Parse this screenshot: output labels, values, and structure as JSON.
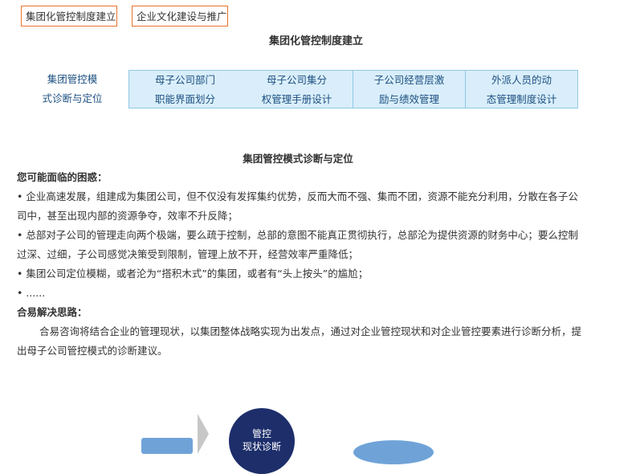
{
  "top_tabs": [
    "集团化管控制度建立",
    "企业文化建设与推广"
  ],
  "section_title": "集团化管控制度建立",
  "subnav": {
    "active": [
      "集团管控模",
      "式诊断与定位"
    ],
    "items": [
      [
        "母子公司部门",
        "职能界面划分"
      ],
      [
        "母子公司集分",
        "权管理手册设计"
      ],
      [
        "子公司经营层激",
        "励与绩效管理"
      ],
      [
        "外派人员的动",
        "态管理制度设计"
      ]
    ]
  },
  "content": {
    "title": "集团管控模式诊断与定位",
    "confusion_heading": "您可能面临的困惑：",
    "bullets": [
      "•  企业高速发展，组建成为集团公司，但不仅没有发挥集约优势，反而大而不强、集而不团，资源不能充分利用，分散在各子公司中，甚至出现内部的资源争夺，效率不升反降；",
      "•  总部对子公司的管理走向两个极端，要么疏于控制，总部的意图不能真正贯彻执行，总部沦为提供资源的财务中心；要么控制过深、过细，子公司感觉决策受到限制，管理上放不开，经营效率严重降低；",
      "•  集团公司定位模糊，或者沦为“搭积木式”的集团，或者有“头上按头”的尴尬；",
      "•  ......"
    ],
    "solution_heading": "合易解决思路：",
    "solution_text": "合易咨询将结合企业的管理现状，以集团整体战略实现为出发点，通过对企业管控现状和对企业管控要素进行诊断分析，提出母子公司管控模式的诊断建议。"
  },
  "diagram": {
    "circle_label_line1": "管控",
    "circle_label_line2": "现状诊断"
  }
}
